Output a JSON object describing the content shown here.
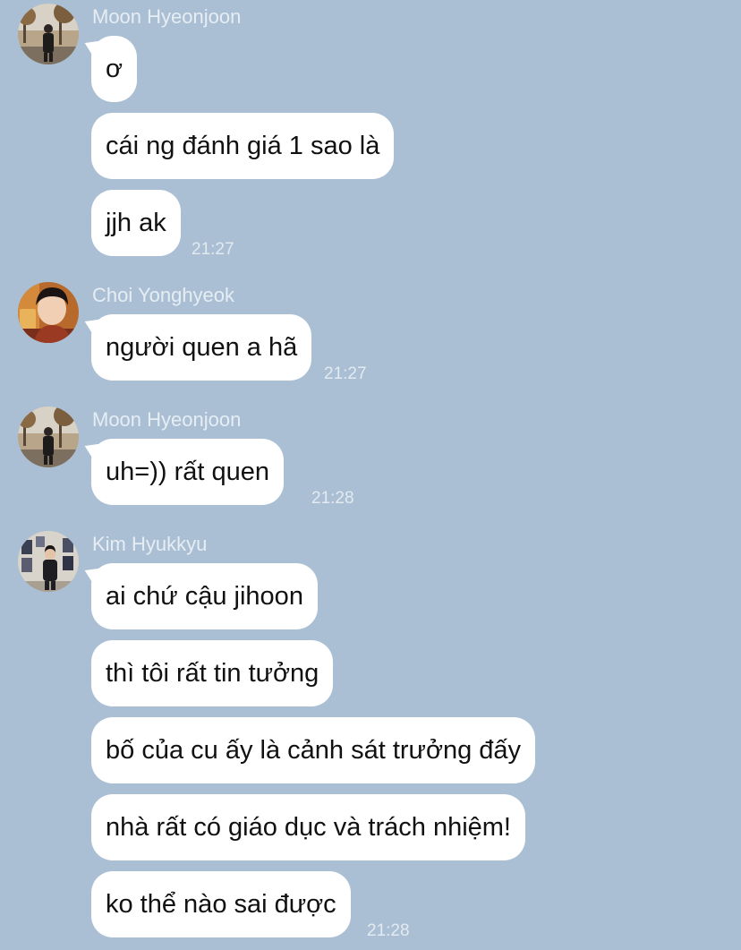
{
  "groups": [
    {
      "sender": "Moon Hyeonjoon",
      "avatar_icon": "user-avatar-photo-outdoor-trees",
      "messages": [
        "ơ",
        "cái ng đánh giá 1 sao là",
        "jjh ak"
      ],
      "time": "21:27"
    },
    {
      "sender": "Choi Yonghyeok",
      "avatar_icon": "user-avatar-photo-portrait",
      "messages": [
        "người quen a hã"
      ],
      "time": "21:27"
    },
    {
      "sender": "Moon Hyeonjoon",
      "avatar_icon": "user-avatar-photo-outdoor-trees",
      "messages": [
        "uh=)) rất quen"
      ],
      "time": "21:28"
    },
    {
      "sender": "Kim Hyukkyu",
      "avatar_icon": "user-avatar-photo-indoor-posters",
      "messages": [
        "ai chứ cậu jihoon",
        "thì tôi rất tin tưởng",
        "bố của cu ấy là cảnh sát trưởng đấy",
        "nhà rất có giáo dục và trách nhiệm!",
        "ko thể nào sai được"
      ],
      "time": "21:28"
    }
  ],
  "colors": {
    "background": "#aabfd3",
    "bubble": "#ffffff",
    "sender_name": "#e6edf4",
    "timestamp": "#e3eaf1"
  }
}
